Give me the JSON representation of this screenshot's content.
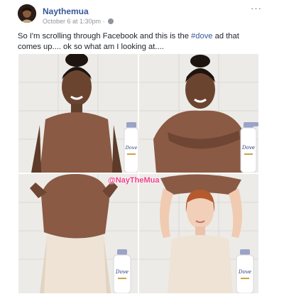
{
  "post": {
    "author_name": "Naythemua",
    "timestamp": "October 6 at 1:30pm",
    "separator": "·",
    "more_icon": "···",
    "text_before": "So I'm scrolling through Facebook and this is the ",
    "hashtag": "#dove",
    "text_after": " ad that comes up.... ok so what am I looking at...."
  },
  "image": {
    "watermark": "@NayTheMua",
    "bottle_brand": "Dove",
    "panels": [
      {
        "name": "panel-1",
        "description_color": "#8b5a42"
      },
      {
        "name": "panel-2",
        "description_color": "#8b5a42"
      },
      {
        "name": "panel-3",
        "description_color": "#efe3d5"
      },
      {
        "name": "panel-4",
        "description_color": "#efe3d5"
      }
    ]
  },
  "colors": {
    "link": "#385898",
    "text": "#1d2129",
    "meta": "#90949c",
    "watermark": "#f1408a",
    "shirt": "#8a5a44",
    "bottle_cap": "#9aa3c8"
  }
}
